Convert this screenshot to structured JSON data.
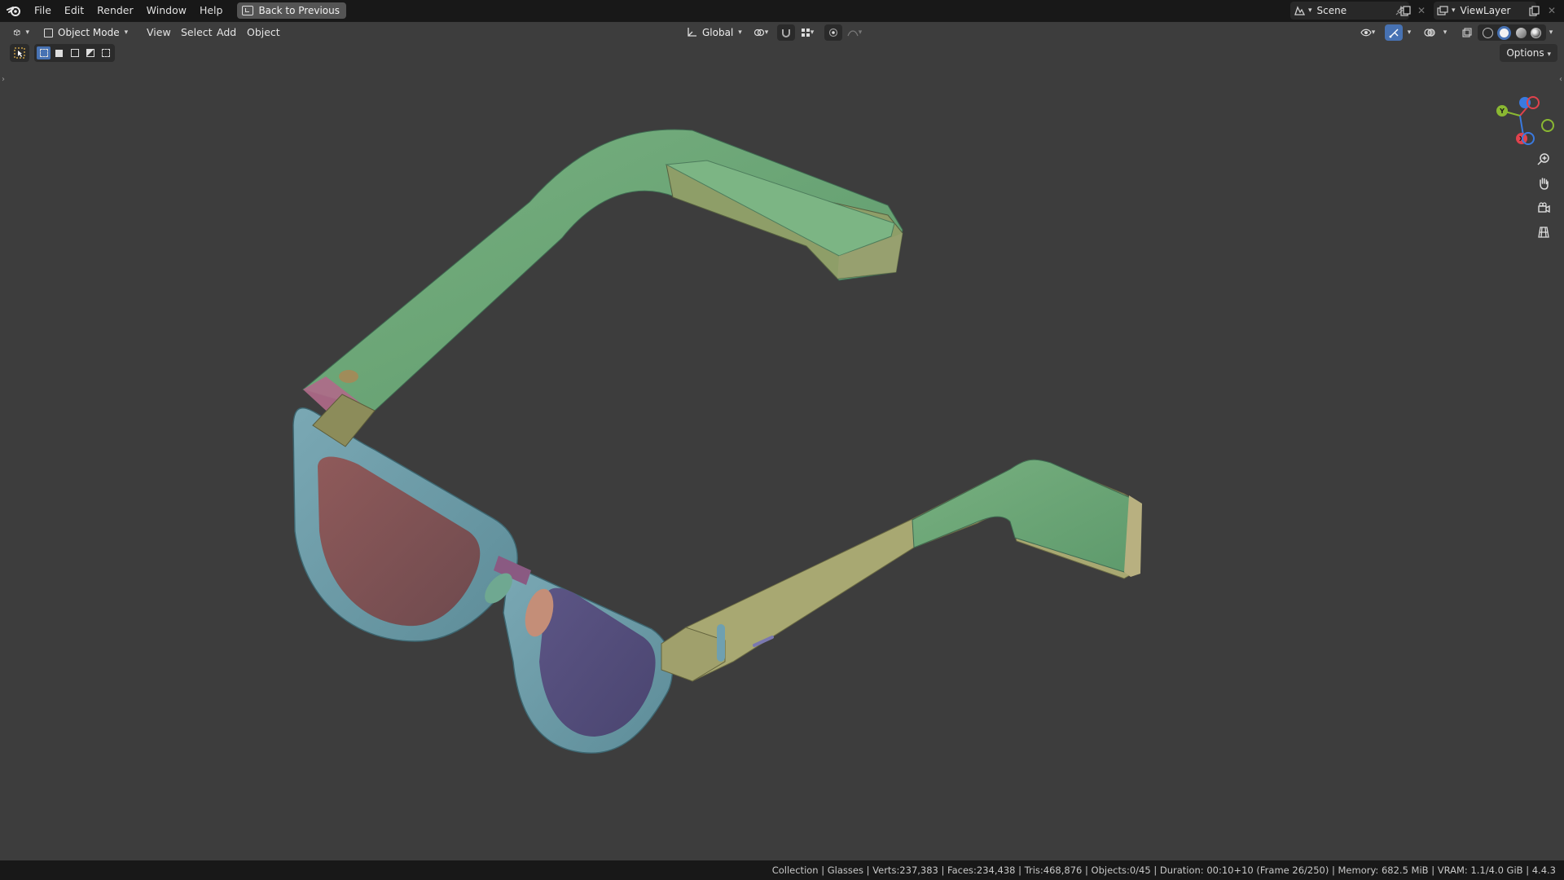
{
  "topbar": {
    "menus": [
      "File",
      "Edit",
      "Render",
      "Window",
      "Help"
    ],
    "back_button": "Back to Previous",
    "scene": "Scene",
    "view_layer": "ViewLayer"
  },
  "viewport_header": {
    "editor_type_icon": "3d-viewport-icon",
    "mode": "Object Mode",
    "menus": [
      "View",
      "Select",
      "Add",
      "Object"
    ],
    "transform_orientation": "Global",
    "options": "Options",
    "shading_mode": "solid"
  },
  "toolbar": {
    "active_tool": "select-box",
    "selection_modes": [
      "set",
      "extend",
      "subtract",
      "difference",
      "intersect"
    ],
    "active_selection_mode": "set"
  },
  "navigation": {
    "buttons": [
      "zoom-icon",
      "hand-pan-icon",
      "camera-icon",
      "grid-ortho-icon"
    ],
    "gizmo_axes": [
      "X",
      "Y",
      "Z"
    ]
  },
  "colors": {
    "axis_x": "#e0424d",
    "axis_y": "#8ab832",
    "axis_z": "#3a7ae0",
    "accent": "#4772b3",
    "viewport_bg": "#3d3d3d"
  },
  "statusbar": {
    "text": "Collection | Glasses | Verts:237,383 | Faces:234,438 | Tris:468,876 | Objects:0/45 | Duration: 00:10+10 (Frame 26/250) | Memory: 682.5 MiB | VRAM: 1.1/4.0 GiB | 4.4.3"
  }
}
